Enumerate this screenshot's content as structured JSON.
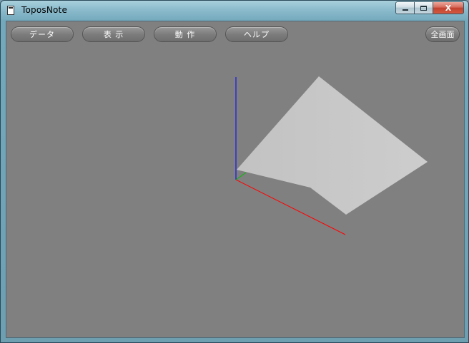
{
  "window": {
    "title": "ToposNote",
    "minimize_label": "",
    "maximize_label": "",
    "close_label": "X"
  },
  "toolbar": {
    "data_label": "データ",
    "view_label": "表 示",
    "action_label": "動 作",
    "help_label": "ヘルプ",
    "fullscreen_label": "全画面"
  },
  "viewport": {
    "background": "#808080",
    "surface_color": "#c8c8c8",
    "axis_x_color": "#ff0000",
    "axis_y_color": "#00c000",
    "axis_z_color": "#0000ff"
  }
}
